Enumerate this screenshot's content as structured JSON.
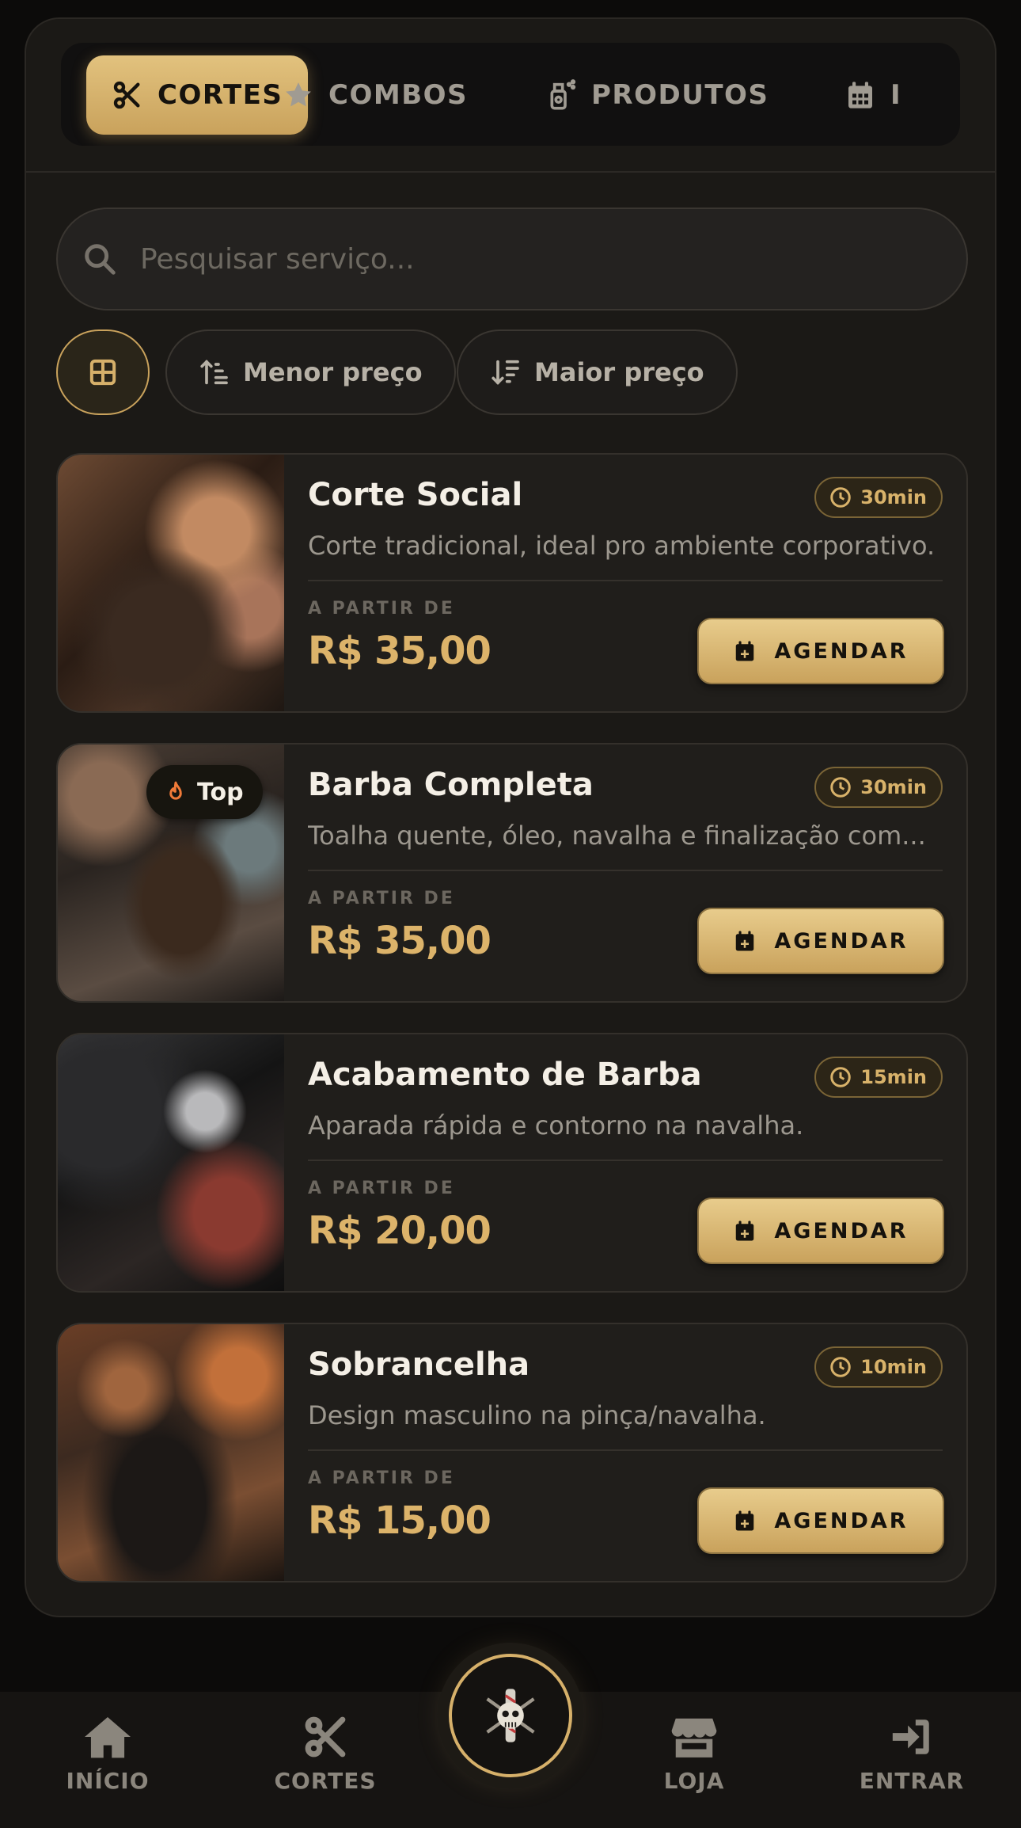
{
  "tabs": [
    {
      "label": "CORTES",
      "icon": "scissors-icon",
      "active": true
    },
    {
      "label": "COMBOS",
      "icon": "star-icon",
      "active": false
    },
    {
      "label": "PRODUTOS",
      "icon": "spray-bottle-icon",
      "active": false
    },
    {
      "label": "I",
      "icon": "calendar-icon",
      "active": false
    }
  ],
  "search": {
    "placeholder": "Pesquisar serviço..."
  },
  "filters": {
    "grid_icon": "grid-icon",
    "sort_asc_label": "Menor preço",
    "sort_desc_label": "Maior preço"
  },
  "services": [
    {
      "title": "Corte Social",
      "duration": "30min",
      "description": "Corte tradicional, ideal pro ambiente corporativo.",
      "from_label": "A PARTIR DE",
      "price": "R$ 35,00",
      "book_label": "AGENDAR",
      "badge": ""
    },
    {
      "title": "Barba Completa",
      "duration": "30min",
      "description": "Toalha quente, óleo, navalha e finalização com...",
      "from_label": "A PARTIR DE",
      "price": "R$ 35,00",
      "book_label": "AGENDAR",
      "badge": "Top"
    },
    {
      "title": "Acabamento de Barba",
      "duration": "15min",
      "description": "Aparada rápida e contorno na navalha.",
      "from_label": "A PARTIR DE",
      "price": "R$ 20,00",
      "book_label": "AGENDAR",
      "badge": ""
    },
    {
      "title": "Sobrancelha",
      "duration": "10min",
      "description": "Design masculino na pinça/navalha.",
      "from_label": "A PARTIR DE",
      "price": "R$ 15,00",
      "book_label": "AGENDAR",
      "badge": ""
    }
  ],
  "bottom_nav": {
    "home": "INÍCIO",
    "cuts": "CORTES",
    "store": "LOJA",
    "login": "ENTRAR"
  },
  "colors": {
    "accent": "#d6b06a",
    "background": "#0c0b0a",
    "card": "#201e1b"
  }
}
